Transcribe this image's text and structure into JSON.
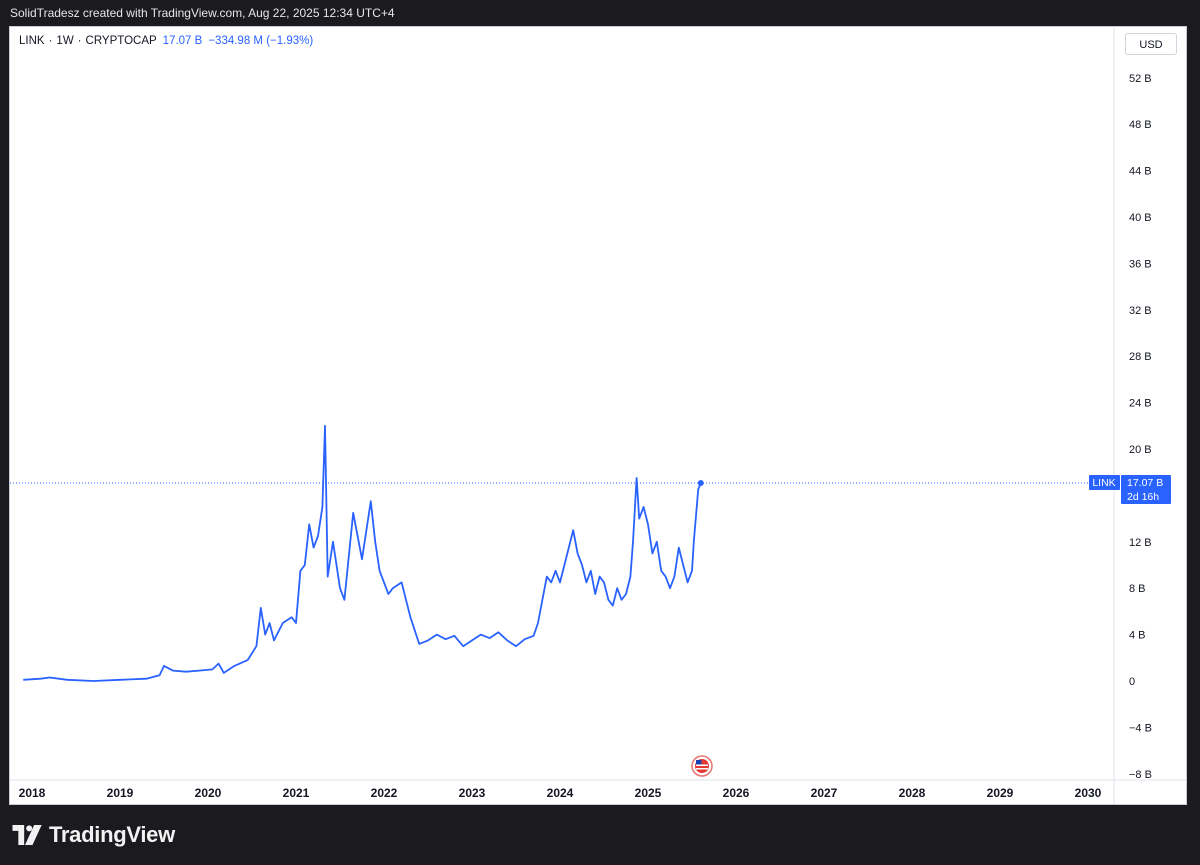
{
  "header": {
    "attribution": "SolidTradesz created with TradingView.com, Aug 22, 2025 12:34 UTC+4"
  },
  "legend": {
    "symbol": "LINK",
    "interval": "1W",
    "source": "CRYPTOCAP",
    "last_value": "17.07 B",
    "change": "−334.98 M (−1.93%)"
  },
  "currency_button": "USD",
  "price_tag": {
    "symbol": "LINK",
    "value": "17.07 B",
    "countdown": "2d 16h"
  },
  "footer": {
    "brand": "TradingView",
    "logo_icon": "tradingview-logo-icon"
  },
  "event_marker": {
    "icon": "us-flag-economic-event-icon"
  },
  "colors": {
    "line": "#2962ff",
    "background": "#ffffff",
    "tag": "#2962ff",
    "page": "#1b1b1f"
  },
  "chart_data": {
    "type": "line",
    "title": "",
    "xlabel": "",
    "ylabel": "",
    "y_unit": "B",
    "ylim": [
      -8,
      54
    ],
    "y_ticks": [
      -8,
      -4,
      0,
      4,
      8,
      12,
      20,
      24,
      28,
      32,
      36,
      40,
      44,
      48,
      52
    ],
    "y_tick_labels": [
      "−8 B",
      "−4 B",
      "0",
      "4 B",
      "8 B",
      "12 B",
      "20 B",
      "24 B",
      "28 B",
      "32 B",
      "36 B",
      "40 B",
      "44 B",
      "48 B",
      "52 B"
    ],
    "x_ticks": [
      2018,
      2019,
      2020,
      2021,
      2022,
      2023,
      2024,
      2025,
      2026,
      2027,
      2028,
      2029,
      2030
    ],
    "x_tick_labels": [
      "2018",
      "2019",
      "2020",
      "2021",
      "2022",
      "2023",
      "2024",
      "2025",
      "2026",
      "2027",
      "2028",
      "2029",
      "2030"
    ],
    "last_value_line": 17.07,
    "grid": false,
    "series": [
      {
        "name": "LINK",
        "points": [
          [
            2017.9,
            0.1
          ],
          [
            2018.1,
            0.2
          ],
          [
            2018.2,
            0.3
          ],
          [
            2018.4,
            0.1
          ],
          [
            2018.7,
            0.0
          ],
          [
            2019.0,
            0.1
          ],
          [
            2019.3,
            0.2
          ],
          [
            2019.45,
            0.5
          ],
          [
            2019.5,
            1.3
          ],
          [
            2019.6,
            0.9
          ],
          [
            2019.75,
            0.8
          ],
          [
            2019.9,
            0.9
          ],
          [
            2020.05,
            1.0
          ],
          [
            2020.12,
            1.5
          ],
          [
            2020.18,
            0.7
          ],
          [
            2020.3,
            1.3
          ],
          [
            2020.45,
            1.8
          ],
          [
            2020.55,
            3.0
          ],
          [
            2020.6,
            6.3
          ],
          [
            2020.65,
            4.0
          ],
          [
            2020.7,
            5.0
          ],
          [
            2020.75,
            3.5
          ],
          [
            2020.85,
            5.0
          ],
          [
            2020.95,
            5.5
          ],
          [
            2021.0,
            5.0
          ],
          [
            2021.05,
            9.5
          ],
          [
            2021.1,
            10.0
          ],
          [
            2021.15,
            13.5
          ],
          [
            2021.2,
            11.5
          ],
          [
            2021.25,
            12.5
          ],
          [
            2021.3,
            15.0
          ],
          [
            2021.33,
            22.0
          ],
          [
            2021.36,
            9.0
          ],
          [
            2021.42,
            12.0
          ],
          [
            2021.5,
            8.0
          ],
          [
            2021.55,
            7.0
          ],
          [
            2021.65,
            14.5
          ],
          [
            2021.75,
            10.5
          ],
          [
            2021.85,
            15.5
          ],
          [
            2021.9,
            12.0
          ],
          [
            2021.95,
            9.5
          ],
          [
            2022.0,
            8.5
          ],
          [
            2022.05,
            7.5
          ],
          [
            2022.1,
            8.0
          ],
          [
            2022.2,
            8.5
          ],
          [
            2022.25,
            7.0
          ],
          [
            2022.3,
            5.5
          ],
          [
            2022.4,
            3.2
          ],
          [
            2022.5,
            3.5
          ],
          [
            2022.6,
            4.0
          ],
          [
            2022.7,
            3.6
          ],
          [
            2022.8,
            3.9
          ],
          [
            2022.9,
            3.0
          ],
          [
            2023.0,
            3.5
          ],
          [
            2023.1,
            4.0
          ],
          [
            2023.2,
            3.7
          ],
          [
            2023.3,
            4.2
          ],
          [
            2023.4,
            3.5
          ],
          [
            2023.5,
            3.0
          ],
          [
            2023.6,
            3.6
          ],
          [
            2023.7,
            3.9
          ],
          [
            2023.75,
            5.0
          ],
          [
            2023.8,
            7.0
          ],
          [
            2023.85,
            9.0
          ],
          [
            2023.9,
            8.5
          ],
          [
            2023.95,
            9.5
          ],
          [
            2024.0,
            8.5
          ],
          [
            2024.05,
            10.0
          ],
          [
            2024.1,
            11.5
          ],
          [
            2024.15,
            13.0
          ],
          [
            2024.2,
            11.0
          ],
          [
            2024.25,
            10.0
          ],
          [
            2024.3,
            8.5
          ],
          [
            2024.35,
            9.5
          ],
          [
            2024.4,
            7.5
          ],
          [
            2024.45,
            9.0
          ],
          [
            2024.5,
            8.5
          ],
          [
            2024.55,
            7.0
          ],
          [
            2024.6,
            6.5
          ],
          [
            2024.65,
            8.0
          ],
          [
            2024.7,
            7.0
          ],
          [
            2024.75,
            7.5
          ],
          [
            2024.8,
            9.0
          ],
          [
            2024.83,
            12.0
          ],
          [
            2024.87,
            17.5
          ],
          [
            2024.9,
            14.0
          ],
          [
            2024.95,
            15.0
          ],
          [
            2025.0,
            13.5
          ],
          [
            2025.05,
            11.0
          ],
          [
            2025.1,
            12.0
          ],
          [
            2025.15,
            9.5
          ],
          [
            2025.2,
            9.0
          ],
          [
            2025.25,
            8.0
          ],
          [
            2025.3,
            9.0
          ],
          [
            2025.35,
            11.5
          ],
          [
            2025.4,
            10.0
          ],
          [
            2025.45,
            8.5
          ],
          [
            2025.5,
            9.5
          ],
          [
            2025.52,
            12.0
          ],
          [
            2025.57,
            16.5
          ],
          [
            2025.6,
            17.07
          ]
        ]
      }
    ]
  }
}
